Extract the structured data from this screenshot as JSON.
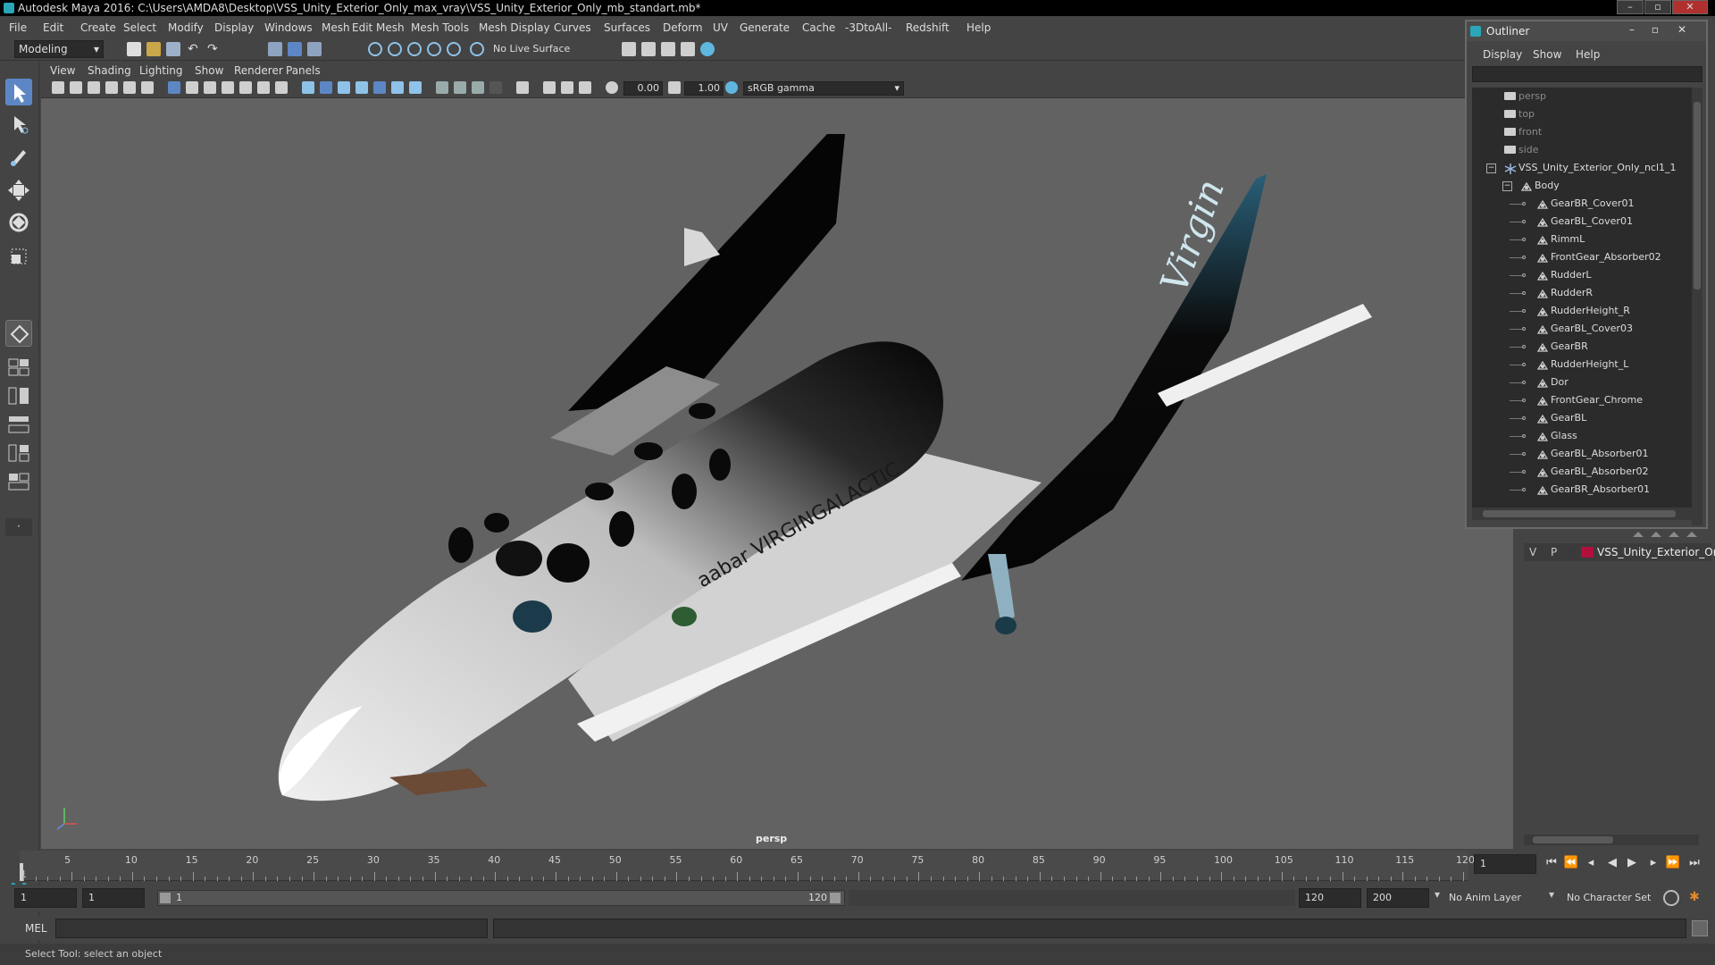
{
  "window": {
    "title": "Autodesk Maya 2016: C:\\Users\\AMDA8\\Desktop\\VSS_Unity_Exterior_Only_max_vray\\VSS_Unity_Exterior_Only_mb_standart.mb*",
    "minimize": "–",
    "maximize": "▫",
    "close": "✕"
  },
  "menubar": [
    "File",
    "Edit",
    "Create",
    "Select",
    "Modify",
    "Display",
    "Windows",
    "Mesh",
    "Edit Mesh",
    "Mesh Tools",
    "Mesh Display",
    "Curves",
    "Surfaces",
    "Deform",
    "UV",
    "Generate",
    "Cache",
    "-3DtoAll-",
    "Redshift",
    "Help"
  ],
  "toolbar": {
    "mode": "Modeling",
    "live_surface": "No Live Surface"
  },
  "panel_menu": [
    "View",
    "Shading",
    "Lighting",
    "Show",
    "Renderer",
    "Panels"
  ],
  "panel_toolbar": {
    "exposure": "0.00",
    "gamma": "1.00",
    "color_space": "sRGB gamma"
  },
  "viewport": {
    "camera": "persp"
  },
  "outliner": {
    "title": "Outliner",
    "menu": [
      "Display",
      "Show",
      "Help"
    ],
    "items": [
      {
        "label": "persp",
        "type": "camera",
        "depth": 0
      },
      {
        "label": "top",
        "type": "camera",
        "depth": 0
      },
      {
        "label": "front",
        "type": "camera",
        "depth": 0
      },
      {
        "label": "side",
        "type": "camera",
        "depth": 0
      },
      {
        "label": "VSS_Unity_Exterior_Only_ncl1_1",
        "type": "group",
        "depth": 0
      },
      {
        "label": "Body",
        "type": "mesh",
        "depth": 1
      },
      {
        "label": "GearBR_Cover01",
        "type": "mesh",
        "depth": 2
      },
      {
        "label": "GearBL_Cover01",
        "type": "mesh",
        "depth": 2
      },
      {
        "label": "RimmL",
        "type": "mesh",
        "depth": 2
      },
      {
        "label": "FrontGear_Absorber02",
        "type": "mesh",
        "depth": 2
      },
      {
        "label": "RudderL",
        "type": "mesh",
        "depth": 2
      },
      {
        "label": "RudderR",
        "type": "mesh",
        "depth": 2
      },
      {
        "label": "RudderHeight_R",
        "type": "mesh",
        "depth": 2
      },
      {
        "label": "GearBL_Cover03",
        "type": "mesh",
        "depth": 2
      },
      {
        "label": "GearBR",
        "type": "mesh",
        "depth": 2
      },
      {
        "label": "RudderHeight_L",
        "type": "mesh",
        "depth": 2
      },
      {
        "label": "Dor",
        "type": "mesh",
        "depth": 2
      },
      {
        "label": "FrontGear_Chrome",
        "type": "mesh",
        "depth": 2
      },
      {
        "label": "GearBL",
        "type": "mesh",
        "depth": 2
      },
      {
        "label": "Glass",
        "type": "mesh",
        "depth": 2
      },
      {
        "label": "GearBL_Absorber01",
        "type": "mesh",
        "depth": 2
      },
      {
        "label": "GearBL_Absorber02",
        "type": "mesh",
        "depth": 2
      },
      {
        "label": "GearBR_Absorber01",
        "type": "mesh",
        "depth": 2
      }
    ]
  },
  "layers": {
    "v": "V",
    "p": "P",
    "name": "VSS_Unity_Exterior_Or",
    "color": "#b0103a"
  },
  "timeline": {
    "ticks": [
      "5",
      "10",
      "15",
      "20",
      "25",
      "30",
      "35",
      "40",
      "45",
      "50",
      "55",
      "60",
      "65",
      "70",
      "75",
      "80",
      "85",
      "90",
      "95",
      "100",
      "105",
      "110",
      "115",
      "120"
    ],
    "zero_label": "1",
    "current_frame": "1"
  },
  "range": {
    "start": "1",
    "anim_start": "1",
    "slider_start": "1",
    "slider_end": "120",
    "end": "120",
    "anim_end": "200",
    "anim_layer": "No Anim Layer",
    "char_set": "No Character Set"
  },
  "cmdline": {
    "label": "MEL"
  },
  "status": {
    "text": "Select Tool: select an object"
  }
}
